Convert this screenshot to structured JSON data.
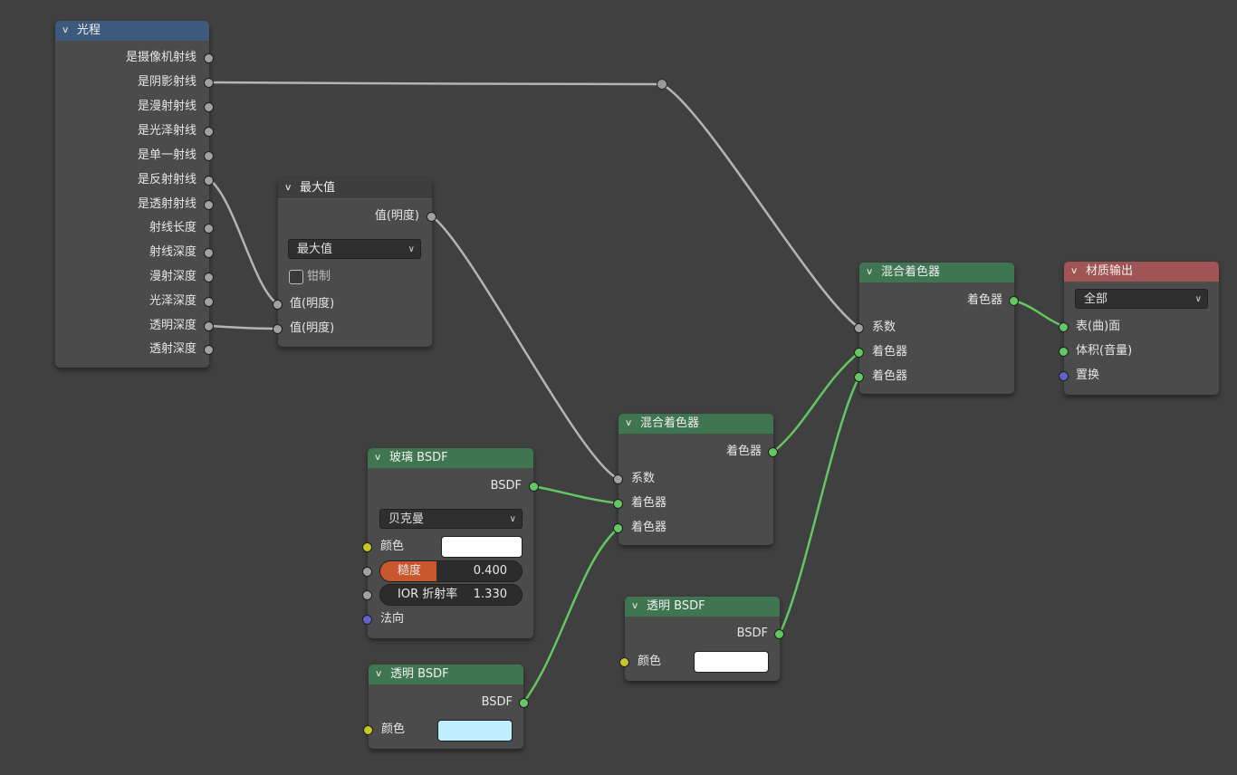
{
  "nodes": {
    "light_path": {
      "title": "光程",
      "outputs": [
        "是摄像机射线",
        "是阴影射线",
        "是漫射射线",
        "是光泽射线",
        "是单一射线",
        "是反射射线",
        "是透射射线",
        "射线长度",
        "射线深度",
        "漫射深度",
        "光泽深度",
        "透明深度",
        "透射深度"
      ]
    },
    "maximum": {
      "title": "最大值",
      "output": "值(明度)",
      "operation": "最大值",
      "clamp_label": "钳制",
      "inputs": [
        "值(明度)",
        "值(明度)"
      ]
    },
    "glass_bsdf": {
      "title": "玻璃 BSDF",
      "output": "BSDF",
      "distribution": "贝克曼",
      "color_label": "颜色",
      "color": "#ffffff",
      "roughness_label": "糙度",
      "roughness": "0.400",
      "roughness_fraction": 0.4,
      "ior_label": "IOR 折射率",
      "ior": "1.330",
      "normal_label": "法向"
    },
    "transparent_bsdf_1": {
      "title": "透明 BSDF",
      "output": "BSDF",
      "color_label": "颜色",
      "color": "#bfeeff"
    },
    "mix_shader_1": {
      "title": "混合着色器",
      "output": "着色器",
      "inputs": [
        "系数",
        "着色器",
        "着色器"
      ]
    },
    "transparent_bsdf_2": {
      "title": "透明 BSDF",
      "output": "BSDF",
      "color_label": "颜色",
      "color": "#ffffff"
    },
    "mix_shader_2": {
      "title": "混合着色器",
      "output": "着色器",
      "inputs": [
        "系数",
        "着色器",
        "着色器"
      ]
    },
    "material_output": {
      "title": "材质输出",
      "target": "全部",
      "inputs": [
        "表(曲)面",
        "体积(音量)",
        "置换"
      ]
    }
  },
  "colors": {
    "header_input": "#3d5a7c",
    "header_shader": "#3f7550",
    "header_output": "#a15454",
    "socket_shader": "#63c763",
    "socket_float": "#a1a1a1",
    "socket_color": "#c7c729",
    "socket_vector": "#6363c7",
    "slider_fill": "#c9572d"
  }
}
